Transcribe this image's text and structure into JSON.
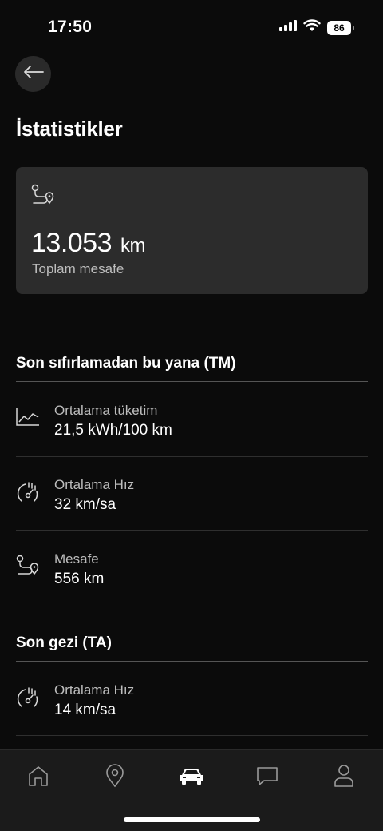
{
  "status_bar": {
    "time": "17:50",
    "battery": "86"
  },
  "page": {
    "title": "İstatistikler"
  },
  "total": {
    "value": "13.053",
    "unit": "km",
    "label": "Toplam mesafe"
  },
  "sections": [
    {
      "title": "Son sıfırlamadan bu yana (TM)",
      "rows": [
        {
          "icon": "chart-line-icon",
          "label": "Ortalama tüketim",
          "value": "21,5 kWh/100 km"
        },
        {
          "icon": "speedometer-icon",
          "label": "Ortalama Hız",
          "value": "32 km/sa"
        },
        {
          "icon": "route-icon",
          "label": "Mesafe",
          "value": "556 km"
        }
      ]
    },
    {
      "title": "Son gezi (TA)",
      "rows": [
        {
          "icon": "speedometer-icon",
          "label": "Ortalama Hız",
          "value": "14 km/sa"
        }
      ]
    }
  ],
  "tabs": [
    {
      "icon": "home-icon"
    },
    {
      "icon": "location-pin-icon"
    },
    {
      "icon": "car-icon",
      "active": true
    },
    {
      "icon": "chat-icon"
    },
    {
      "icon": "profile-icon"
    }
  ]
}
